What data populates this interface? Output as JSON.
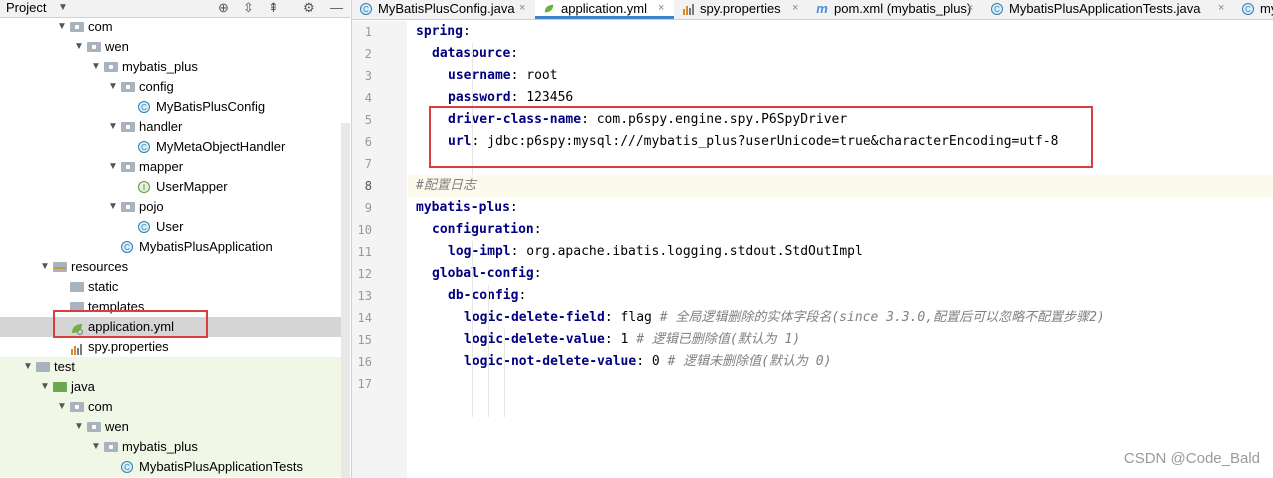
{
  "project_panel": {
    "title": "Project",
    "tree": [
      {
        "label": "com",
        "type": "package",
        "depth": 2,
        "expanded": true
      },
      {
        "label": "wen",
        "type": "package",
        "depth": 3,
        "expanded": true
      },
      {
        "label": "mybatis_plus",
        "type": "package",
        "depth": 4,
        "expanded": true
      },
      {
        "label": "config",
        "type": "package",
        "depth": 5,
        "expanded": true
      },
      {
        "label": "MyBatisPlusConfig",
        "type": "class",
        "depth": 6
      },
      {
        "label": "handler",
        "type": "package",
        "depth": 5,
        "expanded": true
      },
      {
        "label": "MyMetaObjectHandler",
        "type": "class",
        "depth": 6
      },
      {
        "label": "mapper",
        "type": "package",
        "depth": 5,
        "expanded": true
      },
      {
        "label": "UserMapper",
        "type": "interface",
        "depth": 6
      },
      {
        "label": "pojo",
        "type": "package",
        "depth": 5,
        "expanded": true
      },
      {
        "label": "User",
        "type": "class",
        "depth": 6
      },
      {
        "label": "MybatisPlusApplication",
        "type": "app-class",
        "depth": 5
      },
      {
        "label": "resources",
        "type": "resources",
        "depth": 1,
        "expanded": true
      },
      {
        "label": "static",
        "type": "folder",
        "depth": 2
      },
      {
        "label": "templates",
        "type": "folder",
        "depth": 2
      },
      {
        "label": "application.yml",
        "type": "yaml",
        "depth": 2,
        "selected": true
      },
      {
        "label": "spy.properties",
        "type": "properties",
        "depth": 2
      },
      {
        "label": "test",
        "type": "test-folder",
        "depth": 0,
        "expanded": true
      },
      {
        "label": "java",
        "type": "java-folder",
        "depth": 1,
        "expanded": true
      },
      {
        "label": "com",
        "type": "package",
        "depth": 2,
        "expanded": true
      },
      {
        "label": "wen",
        "type": "package",
        "depth": 3,
        "expanded": true
      },
      {
        "label": "mybatis_plus",
        "type": "package",
        "depth": 4,
        "expanded": true
      },
      {
        "label": "MybatisPlusApplicationTests",
        "type": "app-class",
        "depth": 5
      }
    ]
  },
  "editor_tabs": [
    {
      "label": "MyBatisPlusConfig.java",
      "icon": "class-icon",
      "active": false
    },
    {
      "label": "application.yml",
      "icon": "yaml-icon",
      "active": true
    },
    {
      "label": "spy.properties",
      "icon": "properties-icon",
      "active": false
    },
    {
      "label": "pom.xml (mybatis_plus)",
      "icon": "maven-icon",
      "active": false
    },
    {
      "label": "MybatisPlusApplicationTests.java",
      "icon": "class-icon",
      "active": false
    },
    {
      "label": "my",
      "icon": "class-icon",
      "active": false
    }
  ],
  "code_lines": [
    {
      "n": "1",
      "indent": 0,
      "key": "spring",
      "value": "",
      "comment": ""
    },
    {
      "n": "2",
      "indent": 1,
      "key": "datasource",
      "value": "",
      "comment": ""
    },
    {
      "n": "3",
      "indent": 2,
      "key": "username",
      "value": " root",
      "comment": ""
    },
    {
      "n": "4",
      "indent": 2,
      "key": "password",
      "value": " 123456",
      "comment": ""
    },
    {
      "n": "5",
      "indent": 2,
      "key": "driver-class-name",
      "value": " com.p6spy.engine.spy.P6SpyDriver",
      "comment": ""
    },
    {
      "n": "6",
      "indent": 2,
      "key": "url",
      "value": " jdbc:p6spy:mysql:///mybatis_plus?userUnicode=true&characterEncoding=utf-8",
      "comment": ""
    },
    {
      "n": "7",
      "indent": 0,
      "key": "",
      "value": "",
      "comment": ""
    },
    {
      "n": "8",
      "indent": 0,
      "key": "",
      "value": "",
      "comment": "#配置日志",
      "current": true
    },
    {
      "n": "9",
      "indent": 0,
      "key": "mybatis-plus",
      "value": "",
      "comment": ""
    },
    {
      "n": "10",
      "indent": 1,
      "key": "configuration",
      "value": "",
      "comment": ""
    },
    {
      "n": "11",
      "indent": 2,
      "key": "log-impl",
      "value": " org.apache.ibatis.logging.stdout.StdOutImpl",
      "comment": ""
    },
    {
      "n": "12",
      "indent": 1,
      "key": "global-config",
      "value": "",
      "comment": ""
    },
    {
      "n": "13",
      "indent": 2,
      "key": "db-config",
      "value": "",
      "comment": ""
    },
    {
      "n": "14",
      "indent": 3,
      "key": "logic-delete-field",
      "value": " flag ",
      "comment": "# 全局逻辑删除的实体字段名(since 3.3.0,配置后可以忽略不配置步骤2)"
    },
    {
      "n": "15",
      "indent": 3,
      "key": "logic-delete-value",
      "value": " 1 ",
      "comment": "# 逻辑已删除值(默认为 1)"
    },
    {
      "n": "16",
      "indent": 3,
      "key": "logic-not-delete-value",
      "value": " 0 ",
      "comment": "# 逻辑未删除值(默认为 0)"
    },
    {
      "n": "17",
      "indent": 0,
      "key": "",
      "value": "",
      "comment": ""
    }
  ],
  "watermark": "CSDN @Code_Bald",
  "colors": {
    "highlight_box": "#d93e3e",
    "yaml_key": "#000080",
    "comment": "#808080",
    "active_tab": "#4083c9"
  }
}
